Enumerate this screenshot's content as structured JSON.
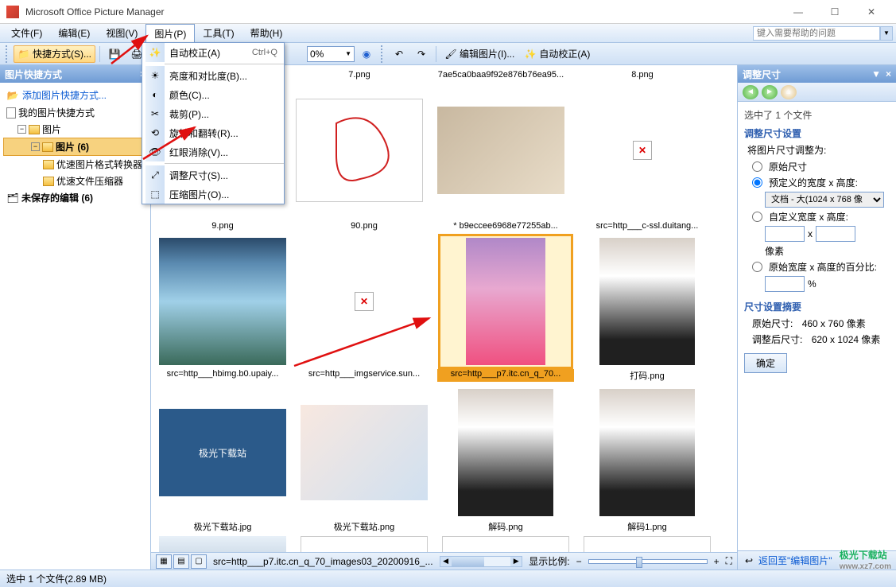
{
  "title": "Microsoft Office Picture Manager",
  "menu": {
    "file": "文件(F)",
    "edit": "编辑(E)",
    "view": "视图(V)",
    "picture": "图片(P)",
    "tools": "工具(T)",
    "help": "帮助(H)"
  },
  "help_placeholder": "键入需要帮助的问题",
  "toolbar": {
    "shortcut": "快捷方式(S)...",
    "zoom": "0%",
    "edit_pic": "编辑图片(I)...",
    "auto_correct": "自动校正(A)"
  },
  "dropdown": {
    "auto": "自动校正(A)",
    "auto_sc": "Ctrl+Q",
    "bright": "亮度和对比度(B)...",
    "color": "颜色(C)...",
    "crop": "裁剪(P)...",
    "rotate": "旋转和翻转(R)...",
    "redeye": "红眼消除(V)...",
    "resize": "调整尺寸(S)...",
    "compress": "压缩图片(O)..."
  },
  "sidebar": {
    "title": "图片快捷方式",
    "add_link": "添加图片快捷方式...",
    "root": "我的图片快捷方式",
    "node_pic": "图片",
    "node_pic_count": "图片 (6)",
    "node_conv": "优速图片格式转换器",
    "node_zip": "优速文件压缩器",
    "unsaved": "未保存的编辑 (6)"
  },
  "thumbs": {
    "r1": [
      "7.png",
      "7ae5ca0baa9f92e876b76ea95...",
      "8.png"
    ],
    "r2f": [
      "9.png",
      "90.png",
      "* b9eccee6968e77255ab...",
      "src=http___c-ssl.duitang..."
    ],
    "r2b": [
      "src=http___hbimg.b0.upaiy...",
      "src=http___imgservice.sun...",
      "src=http___p7.itc.cn_q_70...",
      "打码.png"
    ],
    "r3": [
      "极光下载站.jpg",
      "极光下载站.png",
      "解码.png",
      "解码1.png"
    ]
  },
  "content_bottom": {
    "path": "src=http___p7.itc.cn_q_70_images03_20200916_...",
    "zoom_label": "显示比例:"
  },
  "taskpane": {
    "title": "调整尺寸",
    "selected": "选中了 1 个文件",
    "settings_hdr": "调整尺寸设置",
    "intro": "将图片尺寸调整为:",
    "opt_orig": "原始尺寸",
    "opt_preset": "预定义的宽度 x 高度:",
    "preset_val": "文档 - 大(1024 x 768 像",
    "opt_custom": "自定义宽度 x 高度:",
    "x": "x",
    "unit_px": "像素",
    "opt_pct": "原始宽度 x 高度的百分比:",
    "pct": "%",
    "summary_hdr": "尺寸设置摘要",
    "orig_label": "原始尺寸:",
    "orig_val": "460 x 760 像素",
    "new_label": "调整后尺寸:",
    "new_val": "620 x 1024 像素",
    "ok": "确定",
    "back": "返回至\"编辑图片\""
  },
  "status": "选中 1 个文件(2.89 MB)",
  "watermark": {
    "main": "极光下载站",
    "sub": "www.xz7.com"
  }
}
